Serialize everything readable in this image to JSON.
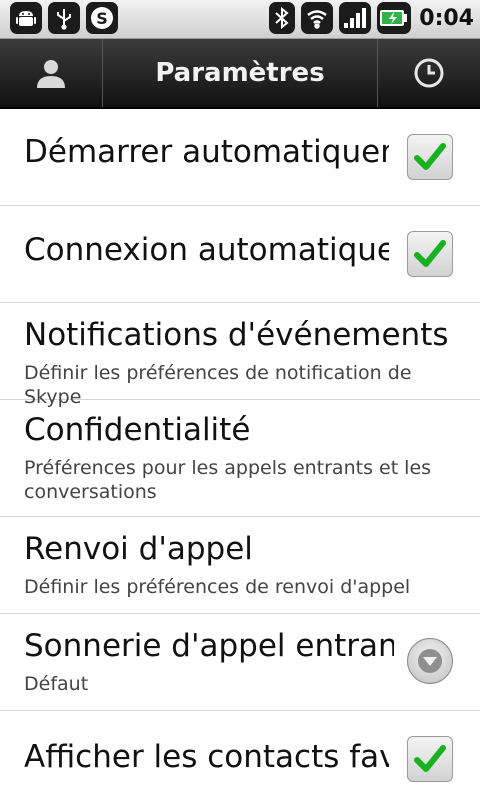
{
  "status_bar": {
    "left_icons": [
      "android-icon",
      "usb-icon",
      "skype-icon"
    ],
    "right_icons": [
      "bluetooth-icon",
      "wifi-icon",
      "signal-icon",
      "battery-icon"
    ],
    "time": "0:04"
  },
  "title_bar": {
    "title": "Paramètres",
    "left_icon": "person-icon",
    "right_icon": "clock-icon"
  },
  "settings": [
    {
      "title": "Démarrer automatiquem",
      "control": "checkbox",
      "checked": true
    },
    {
      "title": "Connexion automatique",
      "control": "checkbox",
      "checked": true
    },
    {
      "title": "Notifications d'événements",
      "subtitle": "Définir les préférences de notification de Skype"
    },
    {
      "title": "Confidentialité",
      "subtitle": "Préférences pour les appels entrants et les conversations"
    },
    {
      "title": "Renvoi d'appel",
      "subtitle": "Définir les préférences de renvoi d'appel"
    },
    {
      "title": "Sonnerie d'appel entrant",
      "subtitle": "Défaut",
      "control": "dropdown"
    },
    {
      "title": "Afficher les contacts favo",
      "control": "checkbox",
      "checked": true
    }
  ],
  "colors": {
    "check_green": "#19b21f",
    "title_bar_bg": "#1b1b1b",
    "divider": "#d6d6d6"
  }
}
